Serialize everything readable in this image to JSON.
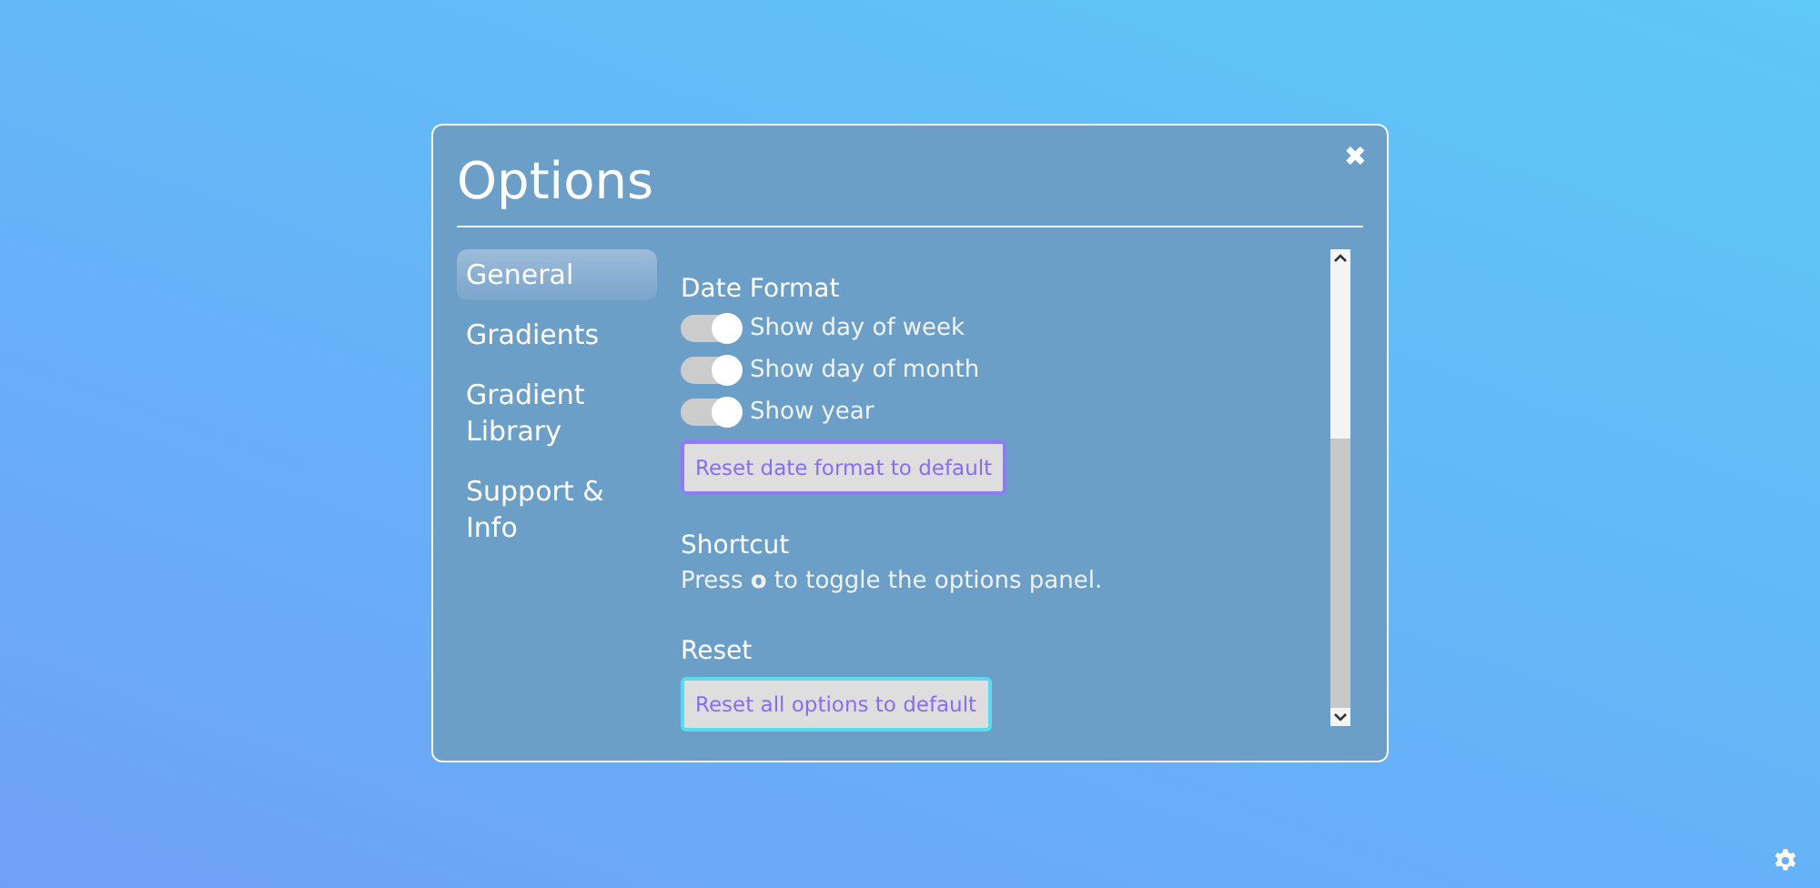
{
  "dialog": {
    "title": "Options",
    "close": "✖"
  },
  "sidebar": {
    "items": [
      {
        "label": "General",
        "selected": true
      },
      {
        "label": "Gradients",
        "selected": false
      },
      {
        "label": "Gradient Library",
        "selected": false
      },
      {
        "label": "Support & Info",
        "selected": false
      }
    ]
  },
  "sections": [
    {
      "heading": "Date Format",
      "toggles": [
        {
          "label": "Show day of week",
          "on": true
        },
        {
          "label": "Show day of month",
          "on": true
        },
        {
          "label": "Show year",
          "on": true
        }
      ],
      "button": {
        "label": "Reset date format to default",
        "focused": false
      }
    },
    {
      "heading": "Shortcut",
      "text": "Press **o** to toggle the options panel."
    },
    {
      "heading": "Reset",
      "button": {
        "label": "Reset all options to default",
        "focused": true
      }
    }
  ]
}
